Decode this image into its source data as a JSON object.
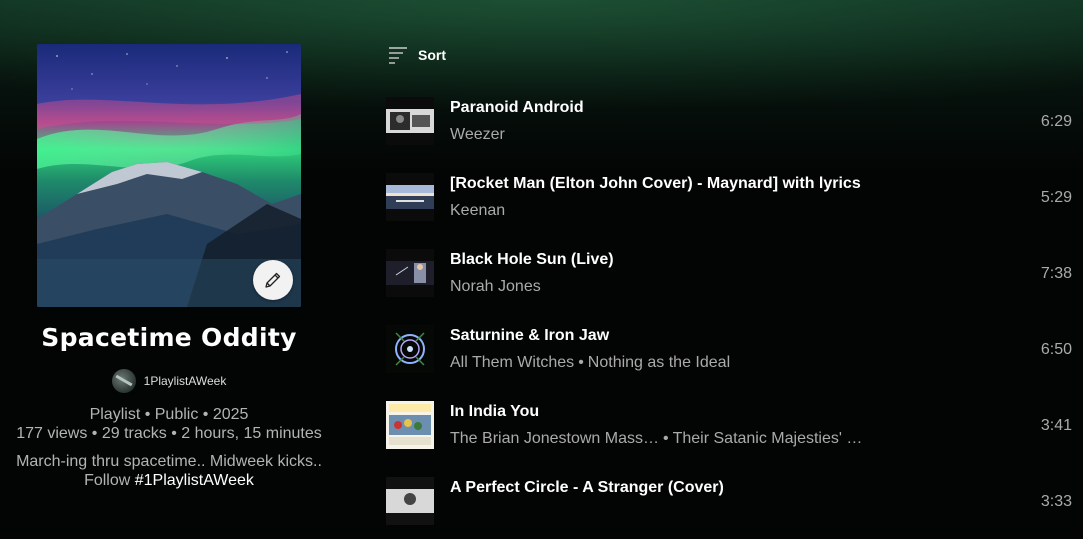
{
  "playlist": {
    "title": "Spacetime Oddity",
    "owner": "1PlaylistAWeek",
    "meta_line1": "Playlist • Public • 2025",
    "meta_line2": "177 views • 29 tracks • 2 hours, 15 minutes",
    "description_line1": "March-ing thru spacetime.. Midweek kicks..",
    "description_prefix": "Follow ",
    "description_hashtag": "#1PlaylistAWeek",
    "edit_icon": "pencil-icon"
  },
  "sort": {
    "label": "Sort",
    "icon": "sort-icon"
  },
  "tracks": [
    {
      "title": "Paranoid Android",
      "artist": "Weezer",
      "album": "",
      "duration": "6:29"
    },
    {
      "title": "[Rocket Man (Elton John Cover) - Maynard] with lyrics",
      "artist": "Keenan",
      "album": "",
      "duration": "5:29"
    },
    {
      "title": "Black Hole Sun (Live)",
      "artist": "Norah Jones",
      "album": "",
      "duration": "7:38"
    },
    {
      "title": "Saturnine & Iron Jaw",
      "artist": "All Them Witches",
      "album": "Nothing as the Ideal",
      "duration": "6:50"
    },
    {
      "title": "In India You",
      "artist": "The Brian Jonestown Mass…",
      "album": "Their Satanic Majesties' S…",
      "duration": "3:41"
    },
    {
      "title": "A Perfect Circle - A Stranger (Cover)",
      "artist": "",
      "album": "",
      "duration": "3:33"
    }
  ],
  "colors": {
    "background": "#030504",
    "glow": "#1f6a45",
    "muted_text": "#aaaaaa"
  }
}
